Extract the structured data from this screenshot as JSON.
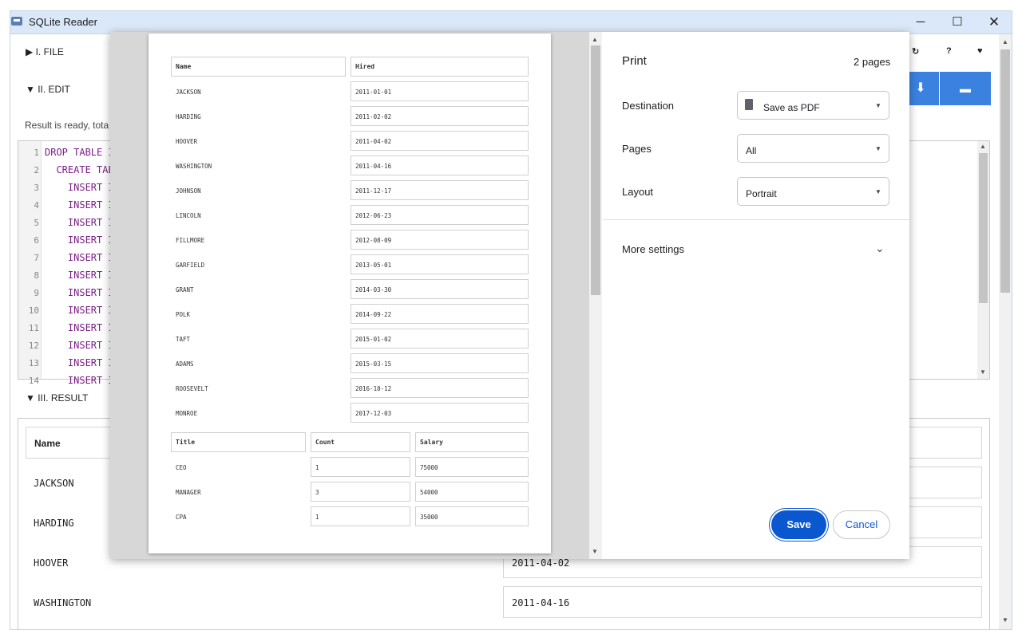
{
  "window": {
    "title": "SQLite Reader",
    "minimize_icon": "minimize-icon",
    "maximize_icon": "maximize-icon",
    "close_icon": "close-icon"
  },
  "sections": {
    "file": "▶ I. FILE",
    "edit": "▼ II. EDIT",
    "result": "▼ III. RESULT"
  },
  "result_status": "Result is ready, tota",
  "editor": {
    "lines": [
      {
        "num": "1",
        "code": "DROP TABLE I"
      },
      {
        "num": "2",
        "code": "  CREATE TAB"
      },
      {
        "num": "3",
        "code": "    INSERT I"
      },
      {
        "num": "4",
        "code": "    INSERT I"
      },
      {
        "num": "5",
        "code": "    INSERT I"
      },
      {
        "num": "6",
        "code": "    INSERT I"
      },
      {
        "num": "7",
        "code": "    INSERT I"
      },
      {
        "num": "8",
        "code": "    INSERT I"
      },
      {
        "num": "9",
        "code": "    INSERT I"
      },
      {
        "num": "10",
        "code": "    INSERT I"
      },
      {
        "num": "11",
        "code": "    INSERT I"
      },
      {
        "num": "12",
        "code": "    INSERT I"
      },
      {
        "num": "13",
        "code": "    INSERT I"
      },
      {
        "num": "14",
        "code": "    INSERT I"
      }
    ]
  },
  "toolbar": {
    "refresh_icon": "↻",
    "help_icon": "?",
    "heart_icon": "♥",
    "download_icon": "⬇",
    "print_icon": "▬"
  },
  "result_table": {
    "header": "Name",
    "rows": [
      {
        "name": "JACKSON",
        "hired": ""
      },
      {
        "name": "HARDING",
        "hired": ""
      },
      {
        "name": "HOOVER",
        "hired": "2011-04-02"
      },
      {
        "name": "WASHINGTON",
        "hired": "2011-04-16"
      }
    ]
  },
  "print": {
    "title": "Print",
    "pages_count": "2 pages",
    "destination_label": "Destination",
    "destination_value": "Save as PDF",
    "pages_label": "Pages",
    "pages_value": "All",
    "layout_label": "Layout",
    "layout_value": "Portrait",
    "more_settings": "More settings",
    "save": "Save",
    "cancel": "Cancel"
  },
  "preview": {
    "table1_headers": [
      "Name",
      "Hired"
    ],
    "table1_rows": [
      [
        "JACKSON",
        "2011-01-01"
      ],
      [
        "HARDING",
        "2011-02-02"
      ],
      [
        "HOOVER",
        "2011-04-02"
      ],
      [
        "WASHINGTON",
        "2011-04-16"
      ],
      [
        "JOHNSON",
        "2011-12-17"
      ],
      [
        "LINCOLN",
        "2012-06-23"
      ],
      [
        "FILLMORE",
        "2012-08-09"
      ],
      [
        "GARFIELD",
        "2013-05-01"
      ],
      [
        "GRANT",
        "2014-03-30"
      ],
      [
        "POLK",
        "2014-09-22"
      ],
      [
        "TAFT",
        "2015-01-02"
      ],
      [
        "ADAMS",
        "2015-03-15"
      ],
      [
        "ROOSEVELT",
        "2016-10-12"
      ],
      [
        "MONROE",
        "2017-12-03"
      ]
    ],
    "table2_headers": [
      "Title",
      "Count",
      "Salary"
    ],
    "table2_rows": [
      [
        "CEO",
        "1",
        "75000"
      ],
      [
        "MANAGER",
        "3",
        "54000"
      ],
      [
        "CPA",
        "1",
        "35000"
      ]
    ]
  }
}
